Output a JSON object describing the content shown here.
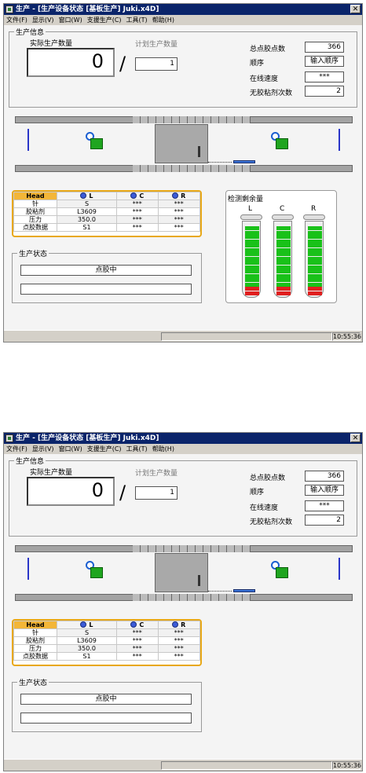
{
  "window": {
    "title": "生产 - [生产设备状态 [基板生产] Juki.x4D]",
    "close_glyph": "✕"
  },
  "menu": [
    "文件(F)",
    "显示(V)",
    "窗口(W)",
    "支援生产(C)",
    "工具(T)",
    "帮助(H)"
  ],
  "production_info": {
    "group_title": "生产信息",
    "actual_label": "实际生产数量",
    "actual_value": "0",
    "separator": "/",
    "planned_label": "计划生产数量",
    "planned_value": "1",
    "total_points_label": "总点胶点数",
    "total_points_value": "366",
    "order_label": "顺序",
    "order_value": "输入顺序",
    "line_speed_label": "在线速度",
    "line_speed_value": "***",
    "no_glue_label": "无胶粘剂次数",
    "no_glue_value": "2"
  },
  "head_table": {
    "header": "Head",
    "columns": [
      "L",
      "C",
      "R"
    ],
    "rows": [
      {
        "label": "针",
        "values": [
          "S",
          "***",
          "***"
        ]
      },
      {
        "label": "胶粘剂",
        "values": [
          "L3609",
          "***",
          "***"
        ]
      },
      {
        "label": "压力",
        "values": [
          "350.0",
          "***",
          "***"
        ]
      },
      {
        "label": "点胶数据",
        "values": [
          "S1",
          "***",
          "***"
        ]
      }
    ]
  },
  "production_status": {
    "group_title": "生产状态",
    "status_text": "点胶中",
    "message_text": ""
  },
  "remaining": {
    "title": "检测剩余量",
    "cartridges": [
      "L",
      "C",
      "R"
    ]
  },
  "colors": {
    "title_bar": "#0a246a",
    "accent_orange": "#f3b638",
    "level_green": "#19c119",
    "level_red": "#e01f1f",
    "robot_green": "#1fa51f",
    "post_blue": "#2a35c8"
  },
  "status_bar": {
    "time": "10:55:36"
  }
}
